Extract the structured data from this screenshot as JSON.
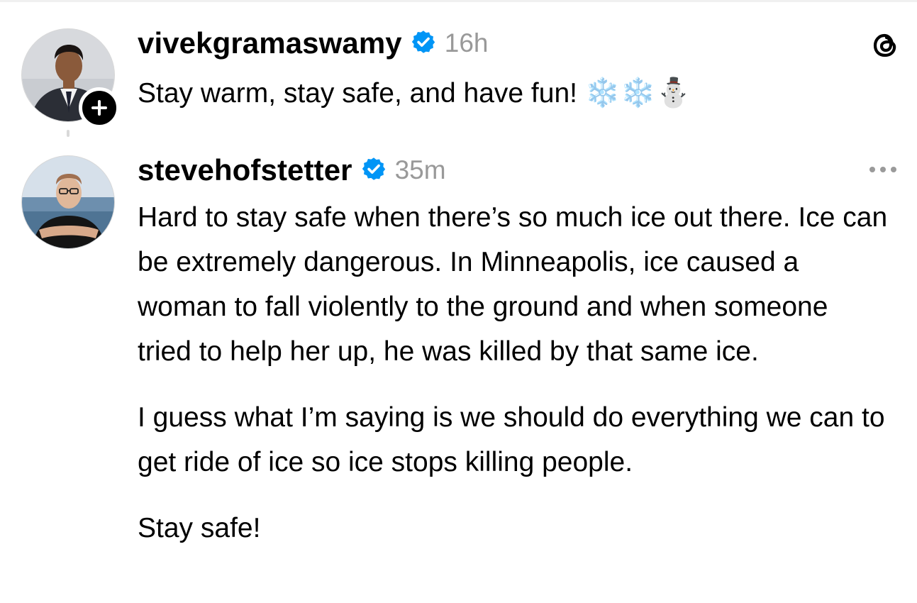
{
  "post1": {
    "username": "vivekgramaswamy",
    "timestamp": "16h",
    "text": "Stay warm, stay safe, and have fun!",
    "emojis": "❄️❄️⛄",
    "avatar_icon": "avatar-photo",
    "follow_icon": "plus-icon",
    "verified_icon": "verified-badge-icon"
  },
  "post2": {
    "username": "stevehofstetter",
    "timestamp": "35m",
    "paragraphs": [
      "Hard to stay safe when there’s so much ice out there. Ice can be extremely dangerous. In Minneapolis, ice caused a woman to fall violently to the ground and when someone tried to help her up, he was killed by that same ice.",
      "I guess what I’m saying is we should do everything we can to get ride of ice so ice stops killing people.",
      "Stay safe!"
    ],
    "avatar_icon": "avatar-photo",
    "verified_icon": "verified-badge-icon",
    "more_icon": "more-options-icon"
  },
  "app": {
    "logo_icon": "threads-logo-icon"
  },
  "colors": {
    "verified": "#0095f6",
    "timestamp": "#999999",
    "text": "#000000"
  }
}
